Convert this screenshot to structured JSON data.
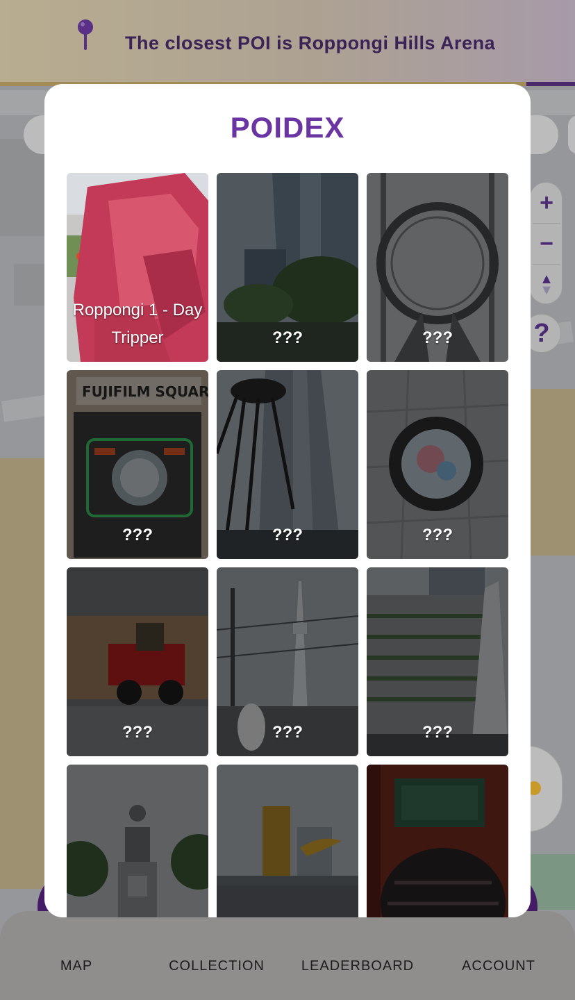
{
  "banner": {
    "text": "The closest POI is Roppongi Hills Arena",
    "icon": "map-pin-icon"
  },
  "modal": {
    "title": "POIDEX"
  },
  "cards": [
    {
      "label": "Roppongi 1 - Day Tripper",
      "found": true,
      "scene": "pink-sculpture"
    },
    {
      "label": "???",
      "found": false,
      "scene": "tower-trees"
    },
    {
      "label": "???",
      "found": false,
      "scene": "ring-structure"
    },
    {
      "label": "???",
      "found": false,
      "scene": "fujifilm-neon"
    },
    {
      "label": "???",
      "found": false,
      "scene": "spider-tower"
    },
    {
      "label": "???",
      "found": false,
      "scene": "manhole"
    },
    {
      "label": "???",
      "found": false,
      "scene": "toy-truck"
    },
    {
      "label": "???",
      "found": false,
      "scene": "skytree"
    },
    {
      "label": "???",
      "found": false,
      "scene": "terraced-building"
    },
    {
      "label": "",
      "found": false,
      "scene": "statue"
    },
    {
      "label": "",
      "found": false,
      "scene": "golden-flame"
    },
    {
      "label": "",
      "found": false,
      "scene": "temple-lantern"
    }
  ],
  "map_controls": {
    "zoom_in": "+",
    "zoom_out": "−",
    "compass": "▲",
    "help": "?"
  },
  "nav": {
    "items": [
      {
        "label": "MAP",
        "icon": "map-icon",
        "active": false
      },
      {
        "label": "COLLECTION",
        "icon": "collection-icon",
        "active": true
      },
      {
        "label": "LEADERBOARD",
        "icon": "leaderboard-icon",
        "active": false
      },
      {
        "label": "ACCOUNT",
        "icon": "account-icon",
        "active": false
      }
    ]
  },
  "colors": {
    "accent": "#6a35a2",
    "nav_bubble": "#441c66",
    "nav_bubble_active": "#b7994f",
    "banner_text": "#3b2357"
  }
}
